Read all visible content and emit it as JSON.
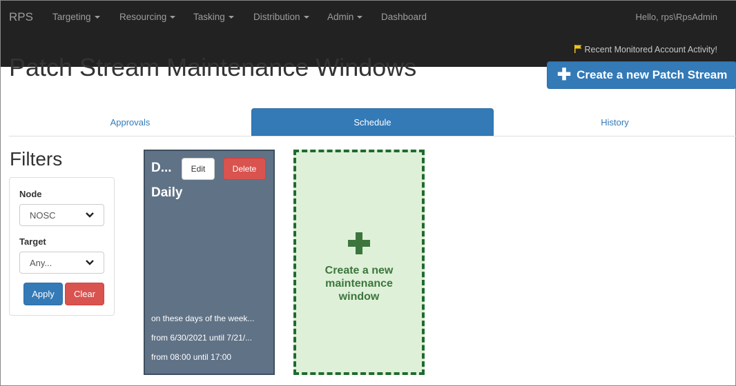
{
  "navbar": {
    "brand": "RPS",
    "items": [
      {
        "label": "Targeting"
      },
      {
        "label": "Resourcing"
      },
      {
        "label": "Tasking"
      },
      {
        "label": "Distribution"
      },
      {
        "label": "Admin"
      },
      {
        "label": "Dashboard"
      }
    ],
    "greeting": "Hello, rps\\RpsAdmin",
    "activity_link": "Recent Monitored Account Activity!"
  },
  "page": {
    "title": "Patch Stream Maintenance Windows",
    "create_button": "Create a new Patch Stream"
  },
  "tabs": [
    {
      "label": "Approvals",
      "active": false
    },
    {
      "label": "Schedule",
      "active": true
    },
    {
      "label": "History",
      "active": false
    }
  ],
  "filters": {
    "title": "Filters",
    "node_label": "Node",
    "node_value": "NOSC",
    "target_label": "Target",
    "target_value": "Any...",
    "apply_label": "Apply",
    "clear_label": "Clear"
  },
  "window_card": {
    "name": "D...",
    "edit_label": "Edit",
    "delete_label": "Delete",
    "frequency": "Daily",
    "days_line": "on these days of the week...",
    "range_line": "from 6/30/2021 until 7/21/...",
    "time_line": "from 08:00 until 17:00"
  },
  "new_window": {
    "label": "Create a new maintenance window"
  },
  "colors": {
    "navbar": "#222222",
    "primary": "#337ab7",
    "danger": "#d9534f",
    "card": "#607286",
    "new_window_bg": "#dff0d8",
    "new_window_border": "#1e6b2e"
  }
}
